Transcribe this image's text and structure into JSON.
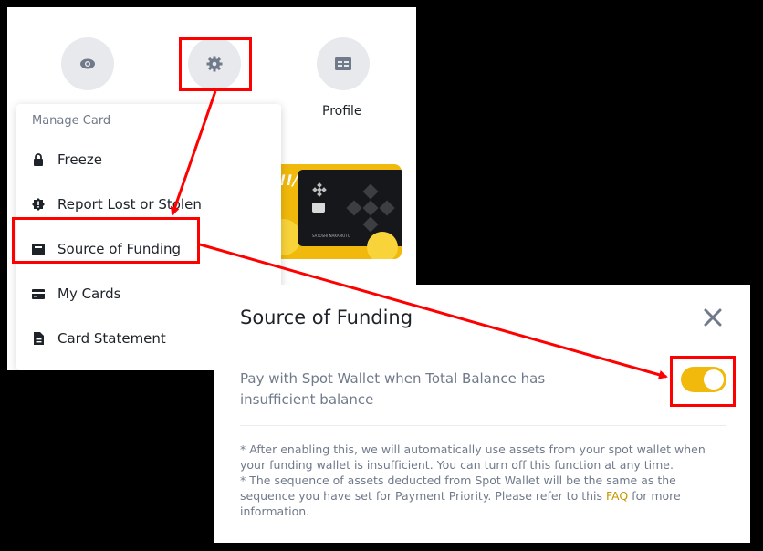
{
  "top": {
    "profile_label": "Profile"
  },
  "card": {
    "holder_name": "SATOSHI NAKAMOTO"
  },
  "menu": {
    "header": "Manage Card",
    "items": [
      {
        "label": "Freeze",
        "icon": "lock-icon"
      },
      {
        "label": "Report Lost or Stolen",
        "icon": "alert-badge-icon"
      },
      {
        "label": "Source of Funding",
        "icon": "wallet-icon"
      },
      {
        "label": "My Cards",
        "icon": "card-icon"
      },
      {
        "label": "Card Statement",
        "icon": "document-icon"
      }
    ]
  },
  "dialog": {
    "title": "Source of Funding",
    "toggle_label": "Pay with Spot Wallet when Total Balance has insufficient balance",
    "toggle_on": true,
    "note1": "* After enabling this, we will automatically use assets from your spot wallet when your funding wallet is insufficient. You can turn off this function at any time.",
    "note2_pre": "* The sequence of assets deducted from Spot Wallet will be the same as the sequence you have set for Payment Priority. Please refer to this ",
    "note2_link": "FAQ",
    "note2_post": " for more information."
  },
  "colors": {
    "accent": "#f0b90b",
    "highlight": "#ff0000",
    "text_primary": "#1e2329",
    "text_secondary": "#707a8a"
  }
}
